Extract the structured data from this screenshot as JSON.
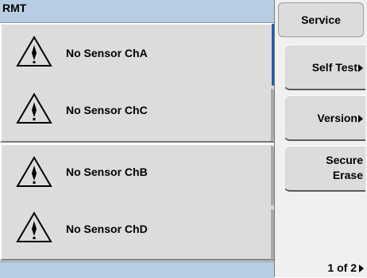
{
  "status_bar": {
    "mode": "RMT"
  },
  "channels": [
    {
      "message": "No Sensor ChA",
      "icon": "warning-triangle-icon"
    },
    {
      "message": "No Sensor ChC",
      "icon": "warning-triangle-icon"
    },
    {
      "message": "No Sensor ChB",
      "icon": "warning-triangle-icon"
    },
    {
      "message": "No Sensor ChD",
      "icon": "warning-triangle-icon"
    }
  ],
  "softkeys": {
    "title": "Service",
    "items": [
      {
        "label": "Self Test",
        "submenu": true
      },
      {
        "label": "Version",
        "submenu": true
      },
      {
        "label_line1": "Secure",
        "label_line2": "Erase",
        "submenu": false
      }
    ],
    "page": "1 of 2"
  },
  "colors": {
    "status_bar": "#b9cde2",
    "selection": "#1a5fb4",
    "window_bg": "#dcdcdc"
  }
}
